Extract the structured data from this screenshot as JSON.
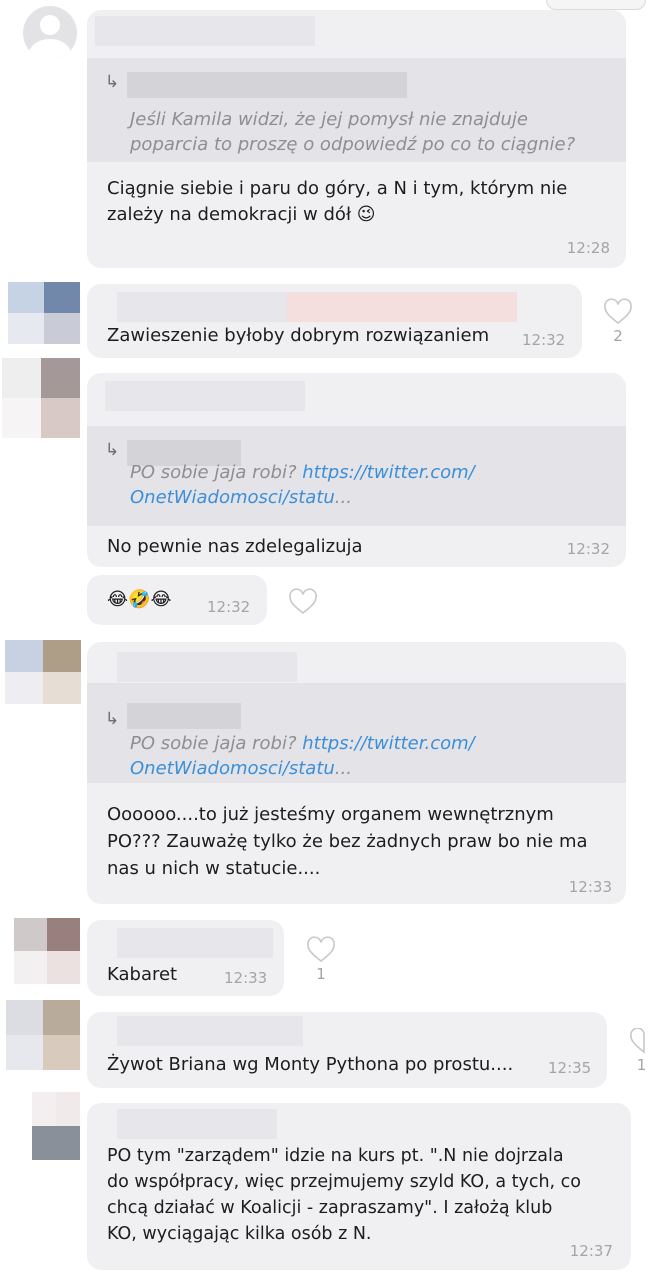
{
  "messages": [
    {
      "quote": "Jeśli Kamila widzi, że jej pomysł nie znajduje\npoparcia to proszę o odpowiedź po co to ciągnie?",
      "text": "Ciągnie siebie i paru do góry, a N i tym,  którym nie\nzależy na demokracji w dół 😉",
      "time": "12:28"
    },
    {
      "text": "Zawieszenie byłoby dobrym rozwiązaniem",
      "time": "12:32",
      "likes": "2"
    },
    {
      "quote_text": "PO sobie jaja robi? ",
      "quote_link": "https://twitter.com/\nOnetWiadomosci/statu",
      "quote_ellipsis": "...",
      "text": "No pewnie nas zdelegalizuja",
      "time": "12:32"
    },
    {
      "text": "😂🤣😂",
      "time": "12:32"
    },
    {
      "quote_text": "PO sobie jaja robi? ",
      "quote_link": "https://twitter.com/\nOnetWiadomosci/statu",
      "quote_ellipsis": "...",
      "text": "Oooooo....to już jesteśmy organem wewnętrznym\nPO??? Zauważę tylko że bez żadnych praw bo nie ma\nnas u nich w statucie....",
      "time": "12:33"
    },
    {
      "text": "Kabaret",
      "time": "12:33",
      "likes": "1"
    },
    {
      "text": "Żywot Briana wg Monty Pythona po prostu....",
      "time": "12:35",
      "likes": "1"
    },
    {
      "text": "PO tym \"zarządem\" idzie na kurs pt. \".N nie dojrzala\ndo współpracy, więc przejmujemy szyld KO, a tych, co\nchcą działać w Koalicji - zapraszamy\". I założą klub\nKO, wyciągając kilka osób z N.",
      "time": "12:37"
    }
  ],
  "icons": {
    "reply": "↳",
    "heart": "heart-outline-icon",
    "avatar_default": "person-silhouette-icon"
  },
  "colors": {
    "bubble": "#f0f0f2",
    "quote_bg": "#e4e4e8",
    "link": "#3b8ed8",
    "muted": "#a4a4a8"
  }
}
